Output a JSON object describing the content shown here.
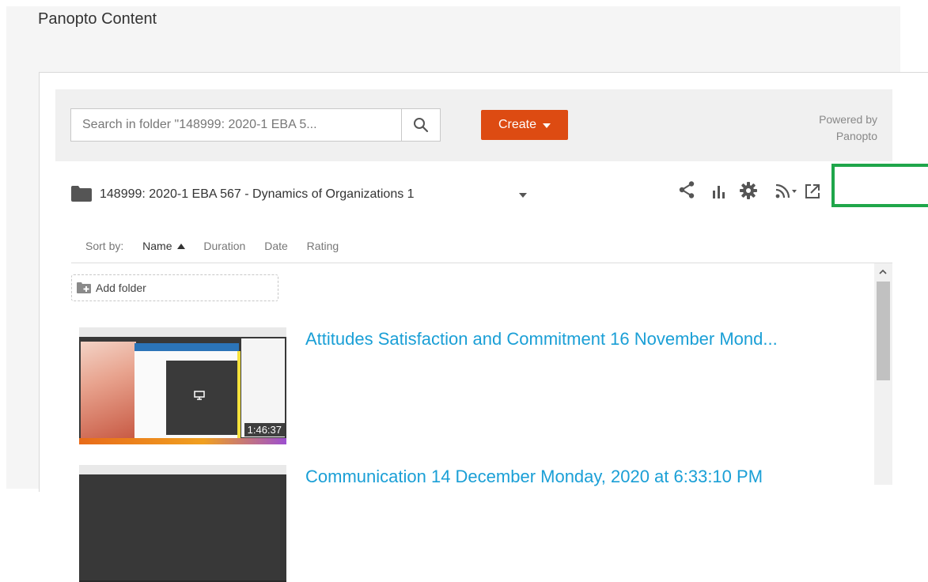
{
  "page_title": "Panopto Content",
  "search": {
    "placeholder": "Search in folder \"148999: 2020-1 EBA 5..."
  },
  "create_button": {
    "label": "Create"
  },
  "powered_by": {
    "line1": "Powered by",
    "line2": "Panopto"
  },
  "folder": {
    "name": "148999: 2020-1 EBA 567 - Dynamics of Organizations 1"
  },
  "toolbar": {
    "icons": [
      "share-icon",
      "stats-icon",
      "settings-icon",
      "rss-icon",
      "open-new-window-icon"
    ]
  },
  "sort": {
    "label": "Sort by:",
    "options": [
      "Name",
      "Duration",
      "Date",
      "Rating"
    ],
    "active": "Name"
  },
  "add_folder": {
    "label": "Add folder"
  },
  "sessions": [
    {
      "title": "Attitudes Satisfaction and Commitment 16 November Mond...",
      "duration": "1:46:37"
    },
    {
      "title": "Communication 14 December Monday, 2020 at 6:33:10 PM",
      "duration": ""
    }
  ],
  "colors": {
    "create": "#dd4b12",
    "link": "#1a9fd6",
    "highlight": "#1fa64a"
  }
}
